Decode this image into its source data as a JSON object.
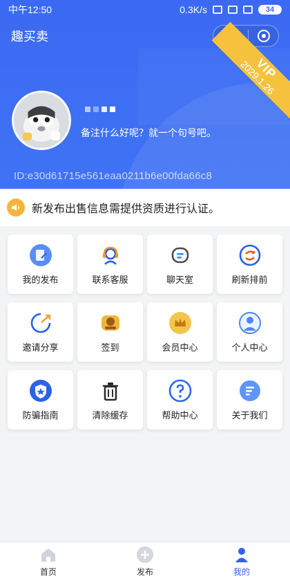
{
  "status": {
    "time": "中午12:50",
    "speed": "0.3K/s",
    "battery": "34"
  },
  "header": {
    "app_title": "趣买卖"
  },
  "vip": {
    "label": "VIP",
    "date": "2029.1.26"
  },
  "profile": {
    "bio": "备注什么好呢？就一个句号吧。",
    "id": "ID:e30d61715e561eaa0211b6e00fda66c8"
  },
  "notice": {
    "text": "新发布出售信息需提供资质进行认证。"
  },
  "grid": {
    "items": [
      {
        "label": "我的发布",
        "icon": "edit-icon"
      },
      {
        "label": "联系客服",
        "icon": "customer-service-icon"
      },
      {
        "label": "聊天室",
        "icon": "chat-icon"
      },
      {
        "label": "刷新排前",
        "icon": "refresh-icon"
      },
      {
        "label": "邀请分享",
        "icon": "share-icon"
      },
      {
        "label": "签到",
        "icon": "checkin-icon"
      },
      {
        "label": "会员中心",
        "icon": "crown-icon"
      },
      {
        "label": "个人中心",
        "icon": "user-icon"
      },
      {
        "label": "防骗指南",
        "icon": "shield-icon"
      },
      {
        "label": "清除缓存",
        "icon": "trash-icon"
      },
      {
        "label": "帮助中心",
        "icon": "help-icon"
      },
      {
        "label": "关于我们",
        "icon": "about-icon"
      }
    ]
  },
  "tabs": [
    {
      "label": "首页",
      "icon": "home-icon"
    },
    {
      "label": "发布",
      "icon": "add-icon"
    },
    {
      "label": "我的",
      "icon": "profile-icon"
    }
  ]
}
